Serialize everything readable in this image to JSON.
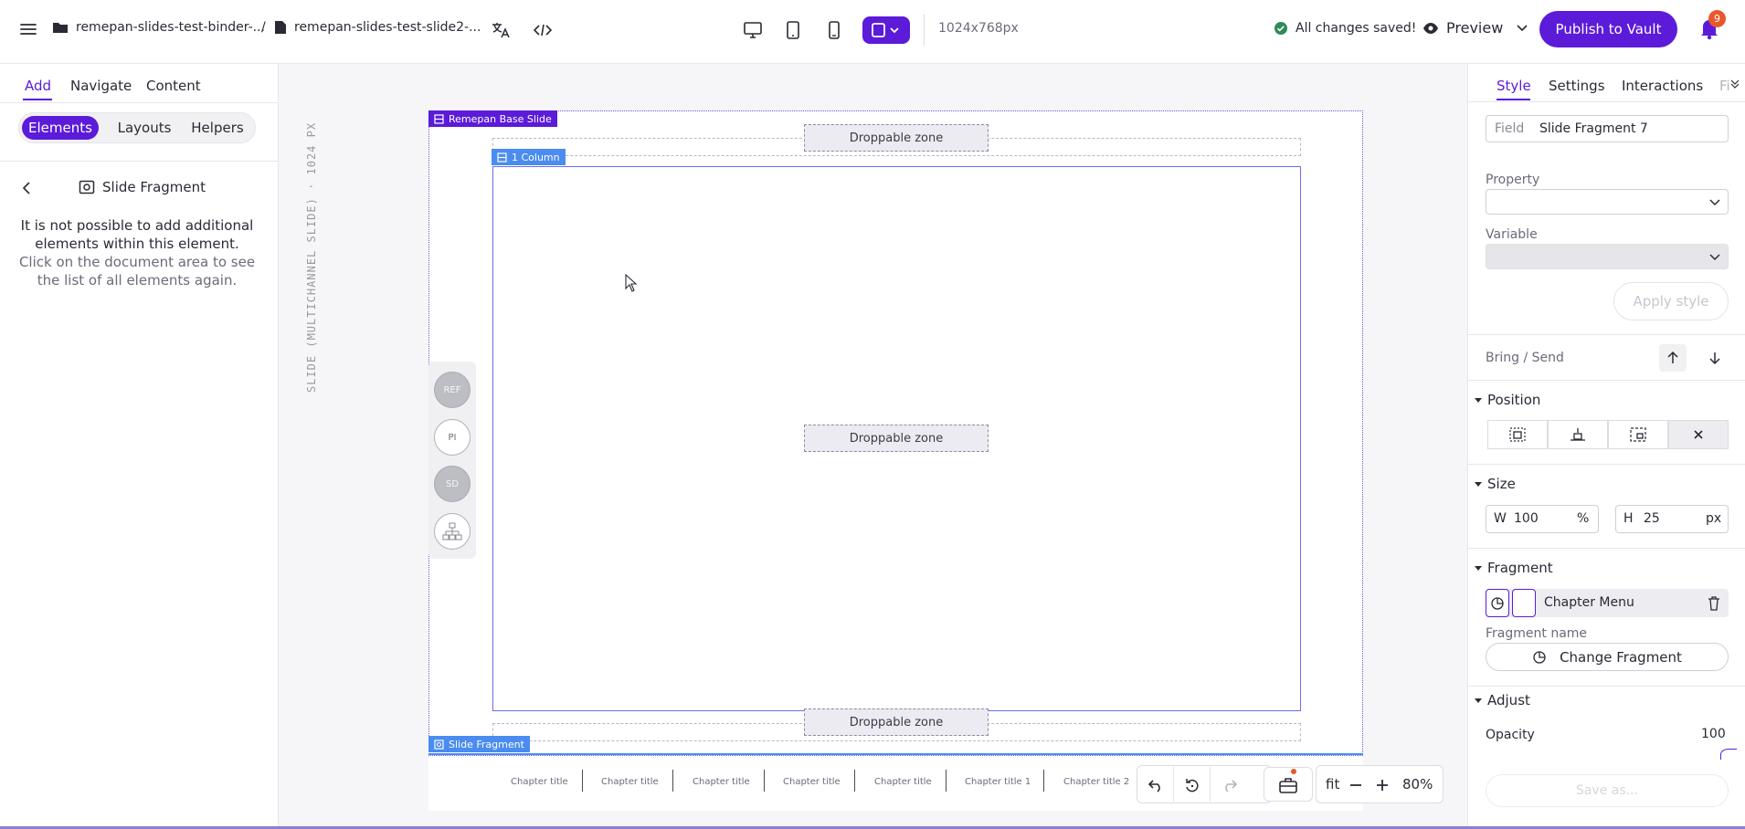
{
  "topbar": {
    "breadcrumb_folder": "remepan-slides-test-binder-...",
    "breadcrumb_sep": "/",
    "breadcrumb_doc": "remepan-slides-test-slide2-...",
    "resolution": "1024x768px",
    "save_status": "All changes saved!",
    "preview_label": "Preview",
    "publish_label": "Publish to Vault",
    "notification_count": "9"
  },
  "left": {
    "tabs": [
      "Add",
      "Navigate",
      "Content"
    ],
    "segments": [
      "Elements",
      "Layouts",
      "Helpers"
    ],
    "fragment_title": "Slide Fragment",
    "message": "It is not possible to add additional elements within this element.",
    "message2": "Click on the document area to see the list of all elements again."
  },
  "canvas": {
    "vertical_label": "SLIDE (MULTICHANNEL SLIDE) · 1024 PX",
    "base_tag": "Remepan Base Slide",
    "column_tag": "1 Column",
    "fragment_tag": "Slide Fragment",
    "drop_label": "Droppable zone",
    "rail": [
      "REF",
      "PI",
      "SD"
    ],
    "chapters": [
      "Chapter title",
      "Chapter title",
      "Chapter title",
      "Chapter title",
      "Chapter title",
      "Chapter title 1",
      "Chapter title 2"
    ],
    "zoom_fit": "fit",
    "zoom_value": "80%"
  },
  "right": {
    "tabs": [
      "Style",
      "Settings",
      "Interactions",
      "Fi"
    ],
    "field_label": "Field",
    "field_value": "Slide Fragment 7",
    "property_label": "Property",
    "variable_label": "Variable",
    "apply_style": "Apply style",
    "bring_send": "Bring / Send",
    "position_label": "Position",
    "size_label": "Size",
    "width_prefix": "W",
    "width_value": "100",
    "width_unit": "%",
    "height_prefix": "H",
    "height_value": "25",
    "height_unit": "px",
    "fragment_label": "Fragment",
    "fragment_item": "Chapter Menu",
    "fragment_name_label": "Fragment name",
    "change_fragment": "Change Fragment",
    "adjust_label": "Adjust",
    "opacity_label": "Opacity",
    "opacity_value": "100",
    "save_as": "Save as..."
  },
  "colors": {
    "accent": "#5b1bd9",
    "blue_tag": "#4a8cf0",
    "success": "#2e8b57",
    "badge": "#e8582a"
  }
}
